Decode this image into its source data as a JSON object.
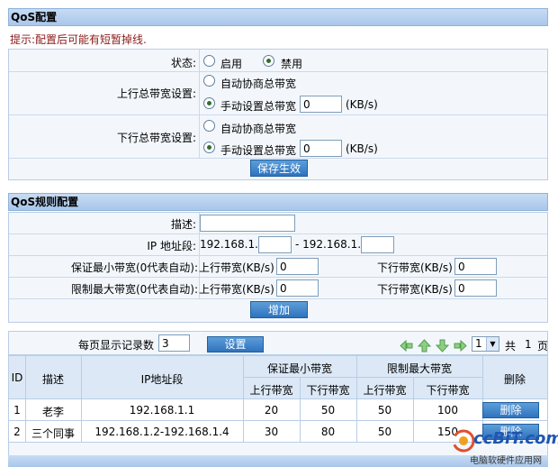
{
  "qos": {
    "title": "QoS配置",
    "hint": "提示:配置后可能有短暂掉线.",
    "status": {
      "label": "状态:",
      "enable": "启用",
      "disable": "禁用",
      "selected": "disable"
    },
    "up": {
      "label": "上行总带宽设置:",
      "auto": "自动协商总带宽",
      "manual": "手动设置总带宽",
      "value": "0",
      "unit": "(KB/s)",
      "selected": "manual"
    },
    "down": {
      "label": "下行总带宽设置:",
      "auto": "自动协商总带宽",
      "manual": "手动设置总带宽",
      "value": "0",
      "unit": "(KB/s)",
      "selected": "manual"
    },
    "save": "保存生效"
  },
  "rules": {
    "title": "QoS规则配置",
    "desc_label": "描述:",
    "desc_value": "",
    "ip_label": "IP 地址段:",
    "ip_prefix1": "192.168.1.",
    "ip_sep": "- 192.168.1.",
    "ip_start": "",
    "ip_end": "",
    "min_label": "保证最小带宽(0代表自动):",
    "max_label": "限制最大带宽(0代表自动):",
    "up_kbs": "上行带宽(KB/s)",
    "down_kbs": "下行带宽(KB/s)",
    "min_up": "0",
    "min_down": "0",
    "max_up": "0",
    "max_down": "0",
    "add": "增加"
  },
  "list": {
    "per_page_label": "每页显示记录数",
    "per_page": "3",
    "set": "设置",
    "page_select": "1",
    "total_prefix": "共",
    "total_pages": "1",
    "total_suffix": "页",
    "headers": {
      "id": "ID",
      "desc": "描述",
      "ip": "IP地址段",
      "min": "保证最小带宽",
      "max": "限制最大带宽",
      "del": "删除",
      "up": "上行带宽",
      "down": "下行带宽"
    },
    "rows": [
      {
        "id": "1",
        "desc": "老李",
        "ip": "192.168.1.1",
        "min_up": "20",
        "min_down": "50",
        "max_up": "50",
        "max_down": "100",
        "del": "删除"
      },
      {
        "id": "2",
        "desc": "三个同事",
        "ip": "192.168.1.2-192.168.1.4",
        "min_up": "30",
        "min_down": "80",
        "max_up": "50",
        "max_down": "150",
        "del": "删除"
      }
    ]
  },
  "watermark": {
    "logo": "ccBiT.com",
    "text": "电脑软硬件应用网"
  }
}
